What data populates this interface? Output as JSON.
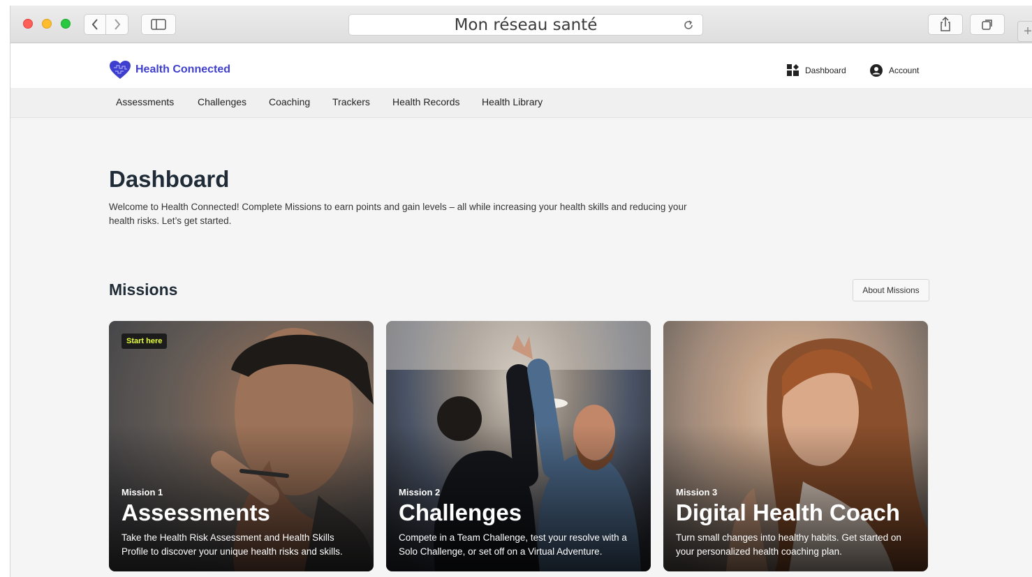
{
  "browser": {
    "address": "Mon réseau santé",
    "new_tab_symbol": "+"
  },
  "site": {
    "brand": "Health Connected",
    "brand_color": "#3f3fcf",
    "header_links": [
      {
        "label": "Dashboard",
        "icon": "dashboard-grid-icon"
      },
      {
        "label": "Account",
        "icon": "account-circle-icon"
      }
    ],
    "nav": [
      "Assessments",
      "Challenges",
      "Coaching",
      "Trackers",
      "Health Records",
      "Health Library"
    ]
  },
  "page": {
    "title": "Dashboard",
    "intro": "Welcome to Health Connected! Complete Missions to earn points and gain levels – all while increasing your health skills and reducing your health risks. Let’s get started.",
    "missions_title": "Missions",
    "about_missions_label": "About Missions"
  },
  "missions": [
    {
      "badge": "Start here",
      "kicker": "Mission 1",
      "title": "Assessments",
      "description": "Take the Health Risk Assessment and Health Skills Profile to discover your unique health risks and skills."
    },
    {
      "kicker": "Mission 2",
      "title": "Challenges",
      "description": "Compete in a Team Challenge, test your resolve with a Solo Challenge, or set off on a Virtual Adventure."
    },
    {
      "kicker": "Mission 3",
      "title": "Digital Health Coach",
      "description": "Turn small changes into healthy habits. Get started on your personalized health coaching plan."
    }
  ]
}
